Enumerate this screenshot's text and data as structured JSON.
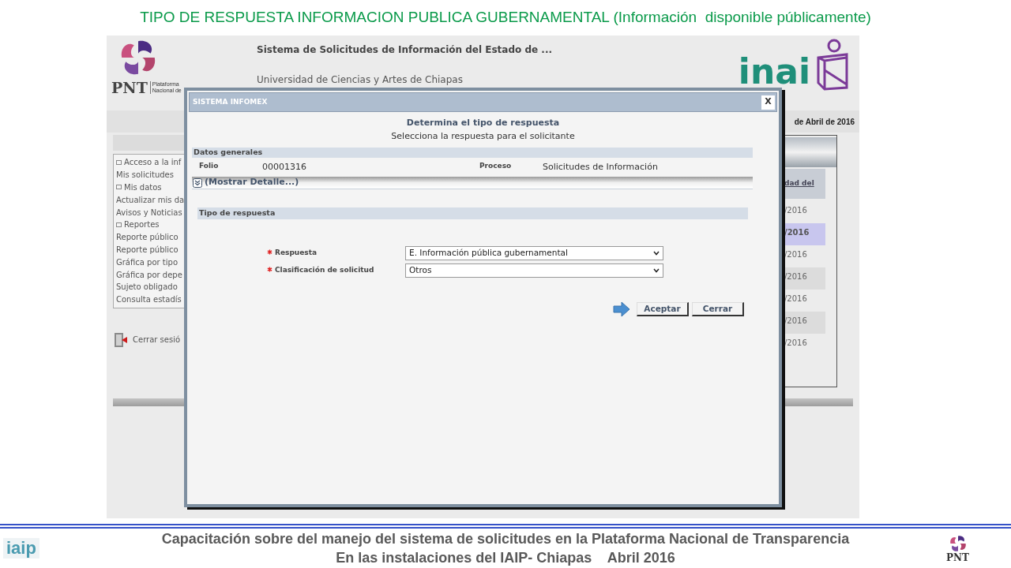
{
  "slide_title": "TIPO DE RESPUESTA INFORMACION PUBLICA GUBERNAMENTAL (Información  disponible públicamente)",
  "app": {
    "logo": {
      "name": "PNT",
      "tagline": [
        "Plataforma",
        "Nacional de"
      ]
    },
    "header_title": "Sistema de Solicitudes de Información del Estado de ...",
    "institution": "Universidad de Ciencias y Artes de Chiapas",
    "partner_logo": "inai",
    "date": "de Abril de 2016",
    "menu": [
      {
        "kind": "section",
        "label": "Acceso a la inf"
      },
      {
        "kind": "link",
        "label": "Mis solicitudes"
      },
      {
        "kind": "section",
        "label": "Mis datos"
      },
      {
        "kind": "link",
        "label": "Actualizar mis da"
      },
      {
        "kind": "link",
        "label": "Avisos y Noticias"
      },
      {
        "kind": "section",
        "label": "Reportes"
      },
      {
        "kind": "link",
        "label": "Reporte público"
      },
      {
        "kind": "link",
        "label": "Reporte público"
      },
      {
        "kind": "link",
        "label": "Gráfica por tipo"
      },
      {
        "kind": "link",
        "label": "Gráfica por depe"
      },
      {
        "kind": "link",
        "label": "Sujeto obligado"
      },
      {
        "kind": "link",
        "label": "Consulta estadís"
      }
    ],
    "logout": "Cerrar sesió",
    "table": {
      "column": "dad del",
      "rows": [
        {
          "date": "/2016",
          "selected": false
        },
        {
          "date": "/2016",
          "selected": true
        },
        {
          "date": "/2016",
          "selected": false
        },
        {
          "date": "/2016",
          "selected": false
        },
        {
          "date": "/2016",
          "selected": false
        },
        {
          "date": "/2016",
          "selected": false
        },
        {
          "date": "/2016",
          "selected": false
        }
      ]
    }
  },
  "dialog": {
    "title": "SISTEMA INFOMEX",
    "close": "X",
    "heading": "Determina el tipo de respuesta",
    "subheading": "Selecciona la respuesta para el solicitante",
    "general": {
      "title": "Datos generales",
      "fields": [
        {
          "label": "Folio",
          "value": "00001316"
        },
        {
          "label": "Proceso",
          "value": "Solicitudes de Información"
        }
      ]
    },
    "details_toggle": "(Mostrar Detalle...)",
    "response_section": "Tipo de respuesta",
    "form": [
      {
        "label": "Respuesta",
        "required": true,
        "value": "E. Información pública gubernamental"
      },
      {
        "label": "Clasificación de solicitud",
        "required": true,
        "value": "Otros"
      }
    ],
    "buttons": [
      "Aceptar",
      "Cerrar"
    ]
  },
  "footer": {
    "left_logo": "iaip",
    "lines": [
      "Capacitación sobre del manejo del sistema de solicitudes en la Plataforma Nacional de Transparencia",
      "En las instalaciones del IAIP- Chiapas    Abril 2016"
    ],
    "right_logo": "PNT"
  }
}
